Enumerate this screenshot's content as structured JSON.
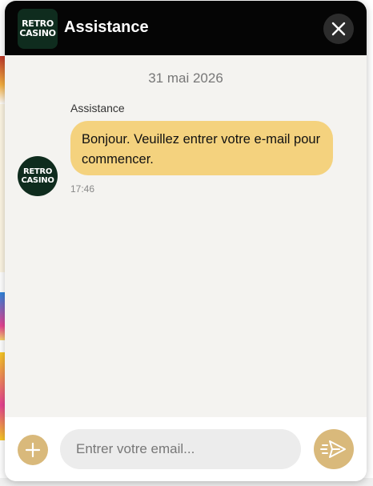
{
  "header": {
    "logo_line1": "RETRO",
    "logo_line2": "CASINO",
    "title": "Assistance"
  },
  "chat": {
    "date": "31 mai 2026",
    "messages": [
      {
        "sender": "Assistance",
        "text": "Bonjour. Veuillez entrer votre e-mail pour commencer.",
        "time": "17:46"
      }
    ]
  },
  "footer": {
    "placeholder": "Entrer votre email..."
  },
  "colors": {
    "header_bg": "#050505",
    "bubble": "#f4d27e",
    "accent": "#d9b97b",
    "logo_bg": "#0f2c1e"
  },
  "icons": {
    "close": "close-icon",
    "plus": "plus-icon",
    "send": "send-icon"
  }
}
